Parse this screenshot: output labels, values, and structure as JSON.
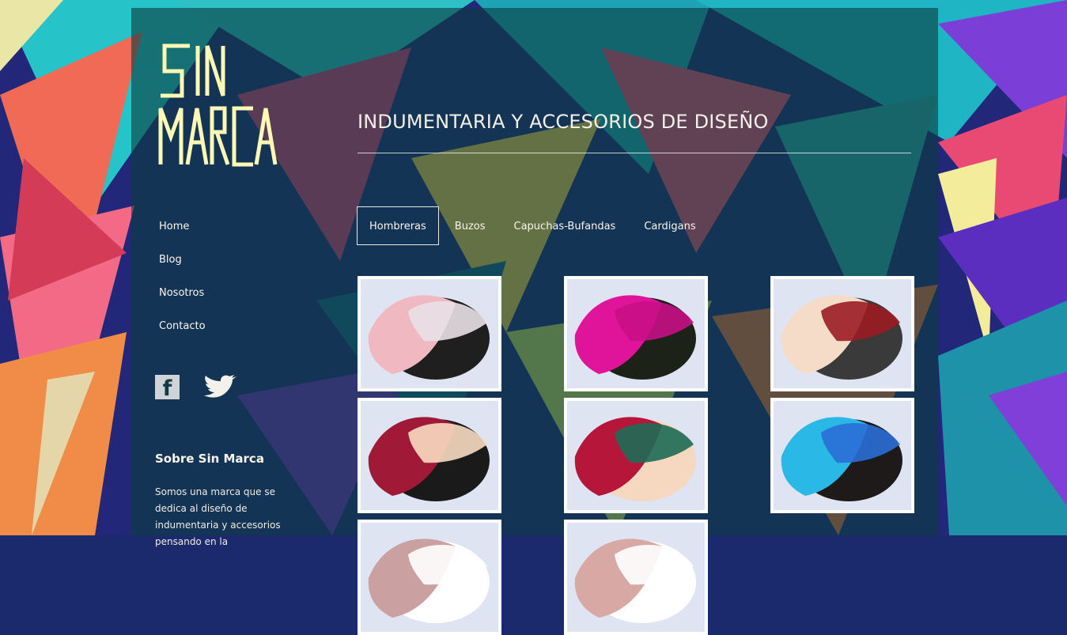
{
  "brand": {
    "logo_text": "SIN MARCA",
    "tagline": "INDUMENTARIA Y ACCESORIOS DE DISEÑO"
  },
  "sidebar": {
    "nav": [
      {
        "label": "Home"
      },
      {
        "label": "Blog"
      },
      {
        "label": "Nosotros"
      },
      {
        "label": "Contacto"
      }
    ],
    "social": [
      {
        "icon": "facebook-icon",
        "glyph": "f"
      },
      {
        "icon": "twitter-icon"
      }
    ],
    "about": {
      "title": "Sobre Sin Marca",
      "text": "Somos una marca que se dedica al diseño de indumentaria y accesorios pensando en la"
    }
  },
  "tabs": [
    {
      "label": "Hombreras",
      "active": true
    },
    {
      "label": "Buzos",
      "active": false
    },
    {
      "label": "Capuchas-Bufandas",
      "active": false
    },
    {
      "label": "Cardigans",
      "active": false
    }
  ],
  "gallery": {
    "items": [
      {
        "colors": [
          "#f0b8c0",
          "#e8e0e6",
          "#1f1f1f"
        ]
      },
      {
        "colors": [
          "#e0139b",
          "#c80f86",
          "#1c2218"
        ]
      },
      {
        "colors": [
          "#f5dcc8",
          "#9b1c24",
          "#3a3a3a"
        ]
      },
      {
        "colors": [
          "#a01a38",
          "#f8dcc2",
          "#1a1a1a"
        ]
      },
      {
        "colors": [
          "#b5163a",
          "#1d6b55",
          "#f6d7bf"
        ]
      },
      {
        "colors": [
          "#2ab8e6",
          "#2a6fd6",
          "#1e1a1a"
        ]
      },
      {
        "colors": [
          "#caa0a0",
          "#ffffff",
          "#ffffff"
        ]
      },
      {
        "colors": [
          "#d7a8a4",
          "#ffffff",
          "#ffffff"
        ]
      }
    ]
  },
  "colors": {
    "panel": "#0c3e40",
    "logo": "#fff7b5",
    "text": "#fbf6ec"
  }
}
